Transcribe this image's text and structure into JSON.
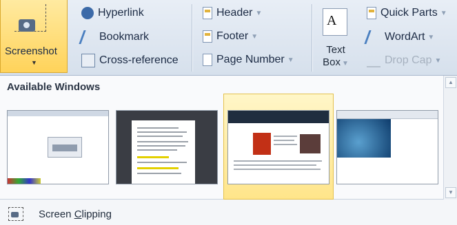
{
  "ribbon": {
    "screenshot_label": "Screenshot",
    "links": [
      {
        "label": "Hyperlink",
        "icon": "hyperlink-icon"
      },
      {
        "label": "Bookmark",
        "icon": "bookmark-icon"
      },
      {
        "label": "Cross-reference",
        "icon": "cross-reference-icon"
      }
    ],
    "header_footer": [
      {
        "label": "Header",
        "icon": "header-icon"
      },
      {
        "label": "Footer",
        "icon": "footer-icon"
      },
      {
        "label": "Page Number",
        "icon": "page-number-icon"
      }
    ],
    "text_box_line1": "Text",
    "text_box_line2": "Box",
    "text_box_glyph": "A",
    "text_items": [
      {
        "label": "Quick Parts",
        "icon": "quick-parts-icon"
      },
      {
        "label": "WordArt",
        "icon": "wordart-icon"
      },
      {
        "label": "Drop Cap",
        "icon": "drop-cap-icon",
        "disabled": true
      }
    ],
    "accent_color": "#ffd35a"
  },
  "gallery": {
    "title": "Available Windows",
    "windows": [
      {
        "name": "window-thumbnail-1",
        "selected": false
      },
      {
        "name": "window-thumbnail-2",
        "selected": false
      },
      {
        "name": "window-thumbnail-3",
        "selected": true
      },
      {
        "name": "window-thumbnail-4",
        "selected": false
      }
    ]
  },
  "screen_clipping": {
    "label_before": "Screen ",
    "label_underlined": "C",
    "label_after": "lipping"
  }
}
